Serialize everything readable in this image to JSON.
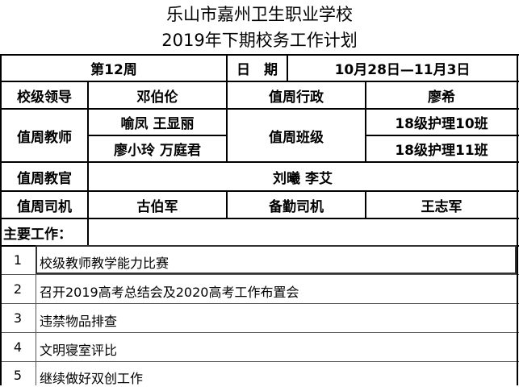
{
  "header": {
    "title_line1": "乐山市嘉州卫生职业学校",
    "title_line2": "2019年下期校务工作计划"
  },
  "info": {
    "week": "第12周",
    "date_label": "日　期",
    "date_range": "10月28日—11月3日",
    "leader_label": "校级领导",
    "leader_value": "邓伯伦",
    "admin_label": "值周行政",
    "admin_value": "廖希",
    "teacher_label": "值周教师",
    "teacher_row1": "喻凤  王显丽",
    "teacher_row2": "廖小玲  万庭君",
    "class_label": "值周班级",
    "class_row1": "18级护理10班",
    "class_row2": "18级护理11班",
    "instructor_label": "值周教官",
    "instructor_value": "刘曦  李艾",
    "driver_label": "值周司机",
    "driver_value": "古伯军",
    "standby_label": "备勤司机",
    "standby_value": "王志军"
  },
  "tasks": {
    "heading": "主要工作：",
    "items": [
      {
        "num": "1",
        "text": "校级教师教学能力比赛"
      },
      {
        "num": "2",
        "text": "召开2019高考总结会及2020高考工作布置会"
      },
      {
        "num": "3",
        "text": "违禁物品排查"
      },
      {
        "num": "4",
        "text": "文明寝室评比"
      },
      {
        "num": "5",
        "text": "继续做好双创工作"
      }
    ]
  }
}
